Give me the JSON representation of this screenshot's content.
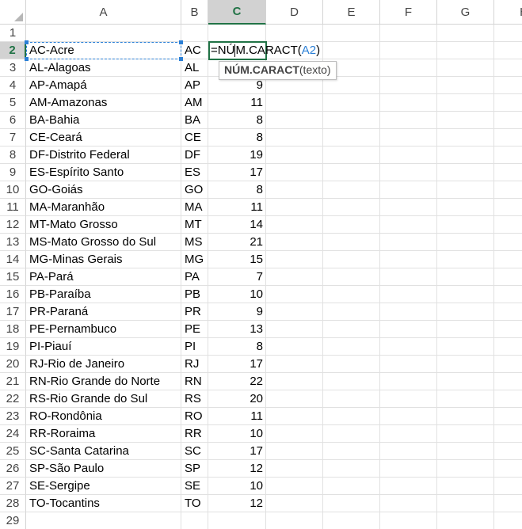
{
  "columns": [
    "A",
    "B",
    "C",
    "D",
    "E",
    "F",
    "G",
    "H"
  ],
  "selected_column": "C",
  "selected_row": 2,
  "row_numbers": [
    "1",
    "2",
    "3",
    "4",
    "5",
    "6",
    "7",
    "8",
    "9",
    "10",
    "11",
    "12",
    "13",
    "14",
    "15",
    "16",
    "17",
    "18",
    "19",
    "20",
    "21",
    "22",
    "23",
    "24",
    "25",
    "26",
    "27",
    "28",
    "29"
  ],
  "rows": [
    {
      "a": "",
      "b": "",
      "c": ""
    },
    {
      "a": "AC-Acre",
      "b": "AC",
      "c": ""
    },
    {
      "a": "AL-Alagoas",
      "b": "AL",
      "c": ""
    },
    {
      "a": "AP-Amapá",
      "b": "AP",
      "c": "9"
    },
    {
      "a": "AM-Amazonas",
      "b": "AM",
      "c": "11"
    },
    {
      "a": "BA-Bahia",
      "b": "BA",
      "c": "8"
    },
    {
      "a": "CE-Ceará",
      "b": "CE",
      "c": "8"
    },
    {
      "a": "DF-Distrito Federal",
      "b": "DF",
      "c": "19"
    },
    {
      "a": "ES-Espírito Santo",
      "b": "ES",
      "c": "17"
    },
    {
      "a": "GO-Goiás",
      "b": "GO",
      "c": "8"
    },
    {
      "a": "MA-Maranhão",
      "b": "MA",
      "c": "11"
    },
    {
      "a": "MT-Mato Grosso",
      "b": "MT",
      "c": "14"
    },
    {
      "a": "MS-Mato Grosso do Sul",
      "b": "MS",
      "c": "21"
    },
    {
      "a": "MG-Minas Gerais",
      "b": "MG",
      "c": "15"
    },
    {
      "a": "PA-Pará",
      "b": "PA",
      "c": "7"
    },
    {
      "a": "PB-Paraíba",
      "b": "PB",
      "c": "10"
    },
    {
      "a": "PR-Paraná",
      "b": "PR",
      "c": "9"
    },
    {
      "a": "PE-Pernambuco",
      "b": "PE",
      "c": "13"
    },
    {
      "a": "PI-Piauí",
      "b": "PI",
      "c": "8"
    },
    {
      "a": "RJ-Rio de Janeiro",
      "b": "RJ",
      "c": "17"
    },
    {
      "a": "RN-Rio Grande do Norte",
      "b": "RN",
      "c": "22"
    },
    {
      "a": "RS-Rio Grande do Sul",
      "b": "RS",
      "c": "20"
    },
    {
      "a": "RO-Rondônia",
      "b": "RO",
      "c": "11"
    },
    {
      "a": "RR-Roraima",
      "b": "RR",
      "c": "10"
    },
    {
      "a": "SC-Santa Catarina",
      "b": "SC",
      "c": "17"
    },
    {
      "a": "SP-São Paulo",
      "b": "SP",
      "c": "12"
    },
    {
      "a": "SE-Sergipe",
      "b": "SE",
      "c": "10"
    },
    {
      "a": "TO-Tocantins",
      "b": "TO",
      "c": "12"
    },
    {
      "a": "",
      "b": "",
      "c": ""
    }
  ],
  "formula_edit": {
    "prefix_before_caret": "=NÚ",
    "prefix_after_caret": "M.CARACT(",
    "reference": "A2",
    "suffix": ")"
  },
  "tooltip": {
    "function_name": "NÚM.CARACT",
    "argument": "(texto)"
  },
  "colors": {
    "selected_header_text": "#217346",
    "reference_blue": "#2a7fd6",
    "header_selected_bg": "#d2d2d2"
  }
}
